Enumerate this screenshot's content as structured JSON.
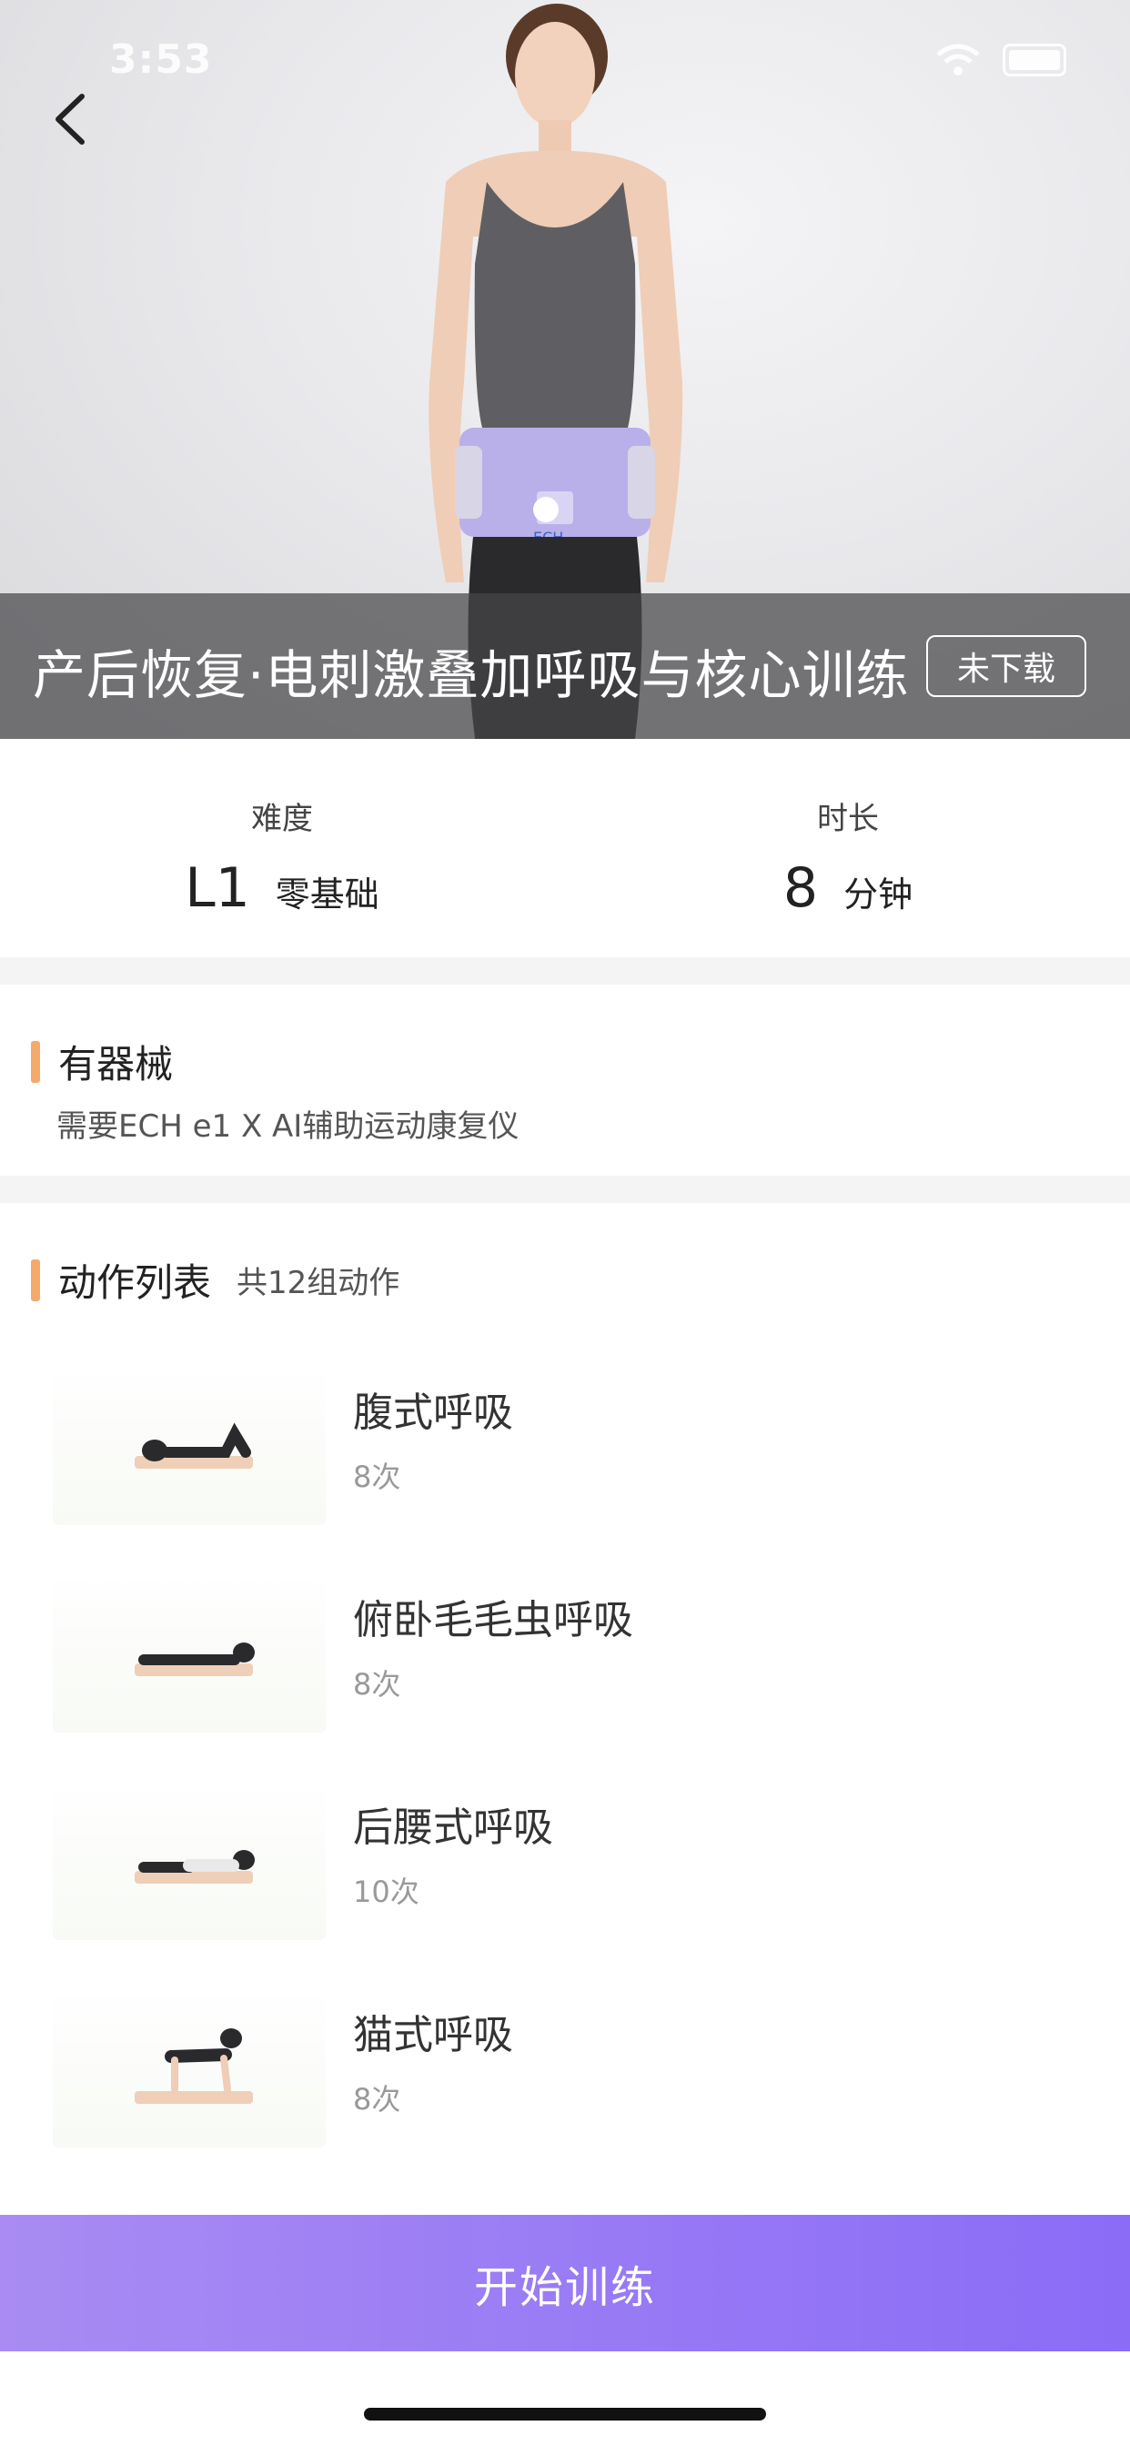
{
  "status": {
    "time": "3:53"
  },
  "hero": {
    "title": "产后恢复·电刺激叠加呼吸与核心训练",
    "download_label": "未下载",
    "belt_text": "ECH"
  },
  "stats": {
    "difficulty": {
      "label": "难度",
      "value": "L1",
      "unit": "零基础"
    },
    "duration": {
      "label": "时长",
      "value": "8",
      "unit": "分钟"
    }
  },
  "equipment": {
    "title": "有器械",
    "description": "需要ECH e1 X AI辅助运动康复仪"
  },
  "actions": {
    "title": "动作列表",
    "count_text": "共12组动作",
    "items": [
      {
        "name": "腹式呼吸",
        "count": "8次"
      },
      {
        "name": "俯卧毛毛虫呼吸",
        "count": "8次"
      },
      {
        "name": "后腰式呼吸",
        "count": "10次"
      },
      {
        "name": "猫式呼吸",
        "count": "8次"
      }
    ]
  },
  "footer": {
    "start_label": "开始训练"
  },
  "colors": {
    "accent": "#f5a96b",
    "button_start": "#a98bf3",
    "button_end": "#8a6cf7",
    "belt": "#b9b0ea"
  }
}
